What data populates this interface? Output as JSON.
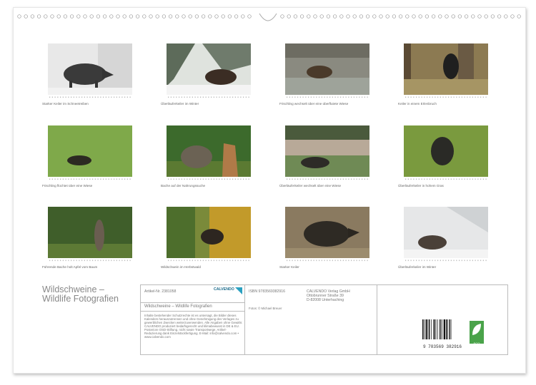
{
  "months": [
    {
      "caption": "Starker Keiler im Schneetreiben"
    },
    {
      "caption": "Überläuferkeiler im Winter"
    },
    {
      "caption": "Frischling wechselt über eine überflutete Wiese"
    },
    {
      "caption": "Keiler in einem Erlenbruch"
    },
    {
      "caption": "Frischling flüchtet über eine Wiese"
    },
    {
      "caption": "Bache auf der Nahrungssuche"
    },
    {
      "caption": "Überläuferkeiler wechselt über eine Wiese"
    },
    {
      "caption": "Überläuferkeiler in hohem Gras"
    },
    {
      "caption": "Führende Bache holt Apfel vom Baum"
    },
    {
      "caption": "Wildschwein im Herbstwald"
    },
    {
      "caption": "Starker Keiler"
    },
    {
      "caption": "Überläuferkeiler im Winter"
    }
  ],
  "title": {
    "line1": "Wildschweine –",
    "line2": "Wildlife Fotografien"
  },
  "info": {
    "article": "Artikel-Nr. 2381058",
    "calvendo": "CALVENDO",
    "subtitle": "Wildschweine – Wildlife Fotografien",
    "disclaimer": "Inhalte bestehender Schutzrechte ist es untersagt, die Bilder dieses Kalenders herauszutrennen und ohne Genehmigung des Verlages zu gewerblichen Zwecken weiterzuverwenden. Alle Angaben ohne Gewähr. CALVENDO produziert bedarfsgerecht und klimabewusst in DE & EU. Posteriore OSD-Stiftung. nicht sowie Transportwege. Artikel-Reduzierung dank Einzelstückfertigung. E-Mail: info@calvendo.com • www.calvendo.com",
    "isbn": "ISBN 9783569382916",
    "photo": "Fotos: © Michael Breuer",
    "publisher": [
      "CALVENDO Verlag GmbH",
      "Ottobrunner Straße 39",
      "D-82008 Unterhaching"
    ],
    "barcode_number": "9 783569 382916",
    "eco_label": "ECO"
  },
  "colors": {
    "page": "#ffffff",
    "green": "#4aa34a",
    "border": "#bbbbbb"
  }
}
